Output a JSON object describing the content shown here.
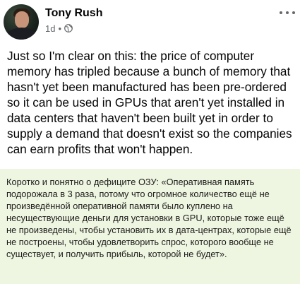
{
  "post": {
    "author": "Tony Rush",
    "age": "1d",
    "separator": "•",
    "audience_icon": "globe-icon",
    "more_icon": "more-horizontal-icon",
    "text": "Just so I'm clear on this:  the price of computer memory has tripled because a bunch of memory that hasn't yet been manufactured has been pre-ordered so it can be used in GPUs that aren't yet installed in data centers that haven't been built yet in order to supply a demand that doesn't exist so the companies can earn profits that won't happen."
  },
  "caption": {
    "text": "Коротко и понятно о дефиците ОЗУ: «Оперативная память подорожала в 3 раза, потому что огромное количество ещё не произведённой оперативной памяти было куплено на несуществующие деньги для установки в GPU, которые тоже ещё не произведены, чтобы установить их в дата-центрах, которые ещё не построены, чтобы удовлетворить спрос, которого вообще не существует, и получить прибыль, которой не будет».",
    "background": "#eef5e0"
  }
}
